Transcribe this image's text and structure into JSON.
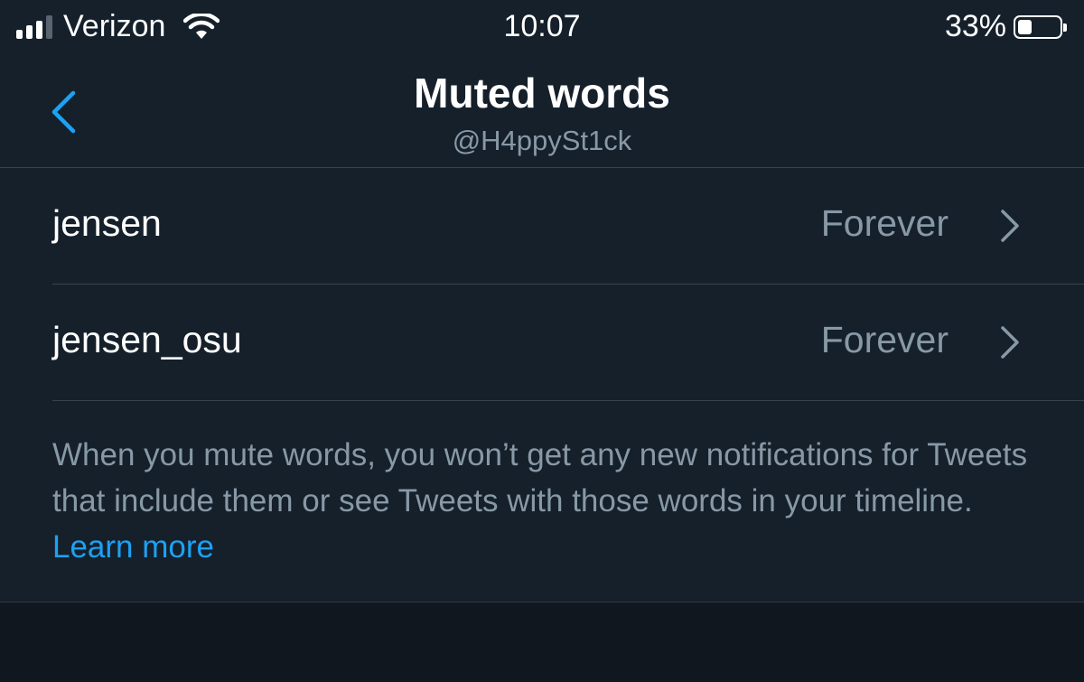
{
  "status_bar": {
    "carrier": "Verizon",
    "time": "10:07",
    "battery_percent": "33%",
    "battery_level": 0.33,
    "signal_bars": 3,
    "icons": [
      "signal-bars-icon",
      "wifi-icon",
      "battery-icon"
    ]
  },
  "header": {
    "title": "Muted words",
    "subtitle": "@H4ppySt1ck",
    "back_icon": "chevron-left-icon"
  },
  "muted_words": [
    {
      "word": "jensen",
      "duration": "Forever"
    },
    {
      "word": "jensen_osu",
      "duration": "Forever"
    }
  ],
  "description": {
    "text": "When you mute words, you won’t get any new notifications for Tweets that include them or see Tweets with those words in your timeline. ",
    "link_label": "Learn more"
  },
  "colors": {
    "background": "#15202b",
    "accent": "#1da1f2",
    "secondary_text": "#8899a6",
    "divider": "#38444d"
  }
}
